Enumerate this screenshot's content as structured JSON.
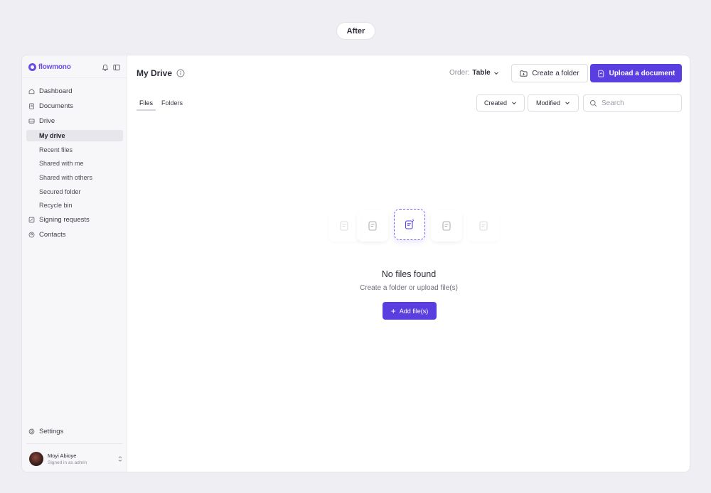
{
  "badge": "After",
  "brand": {
    "name": "flowmono"
  },
  "sidebar": {
    "items": [
      {
        "label": "Dashboard",
        "icon": "home-icon"
      },
      {
        "label": "Documents",
        "icon": "document-icon"
      },
      {
        "label": "Drive",
        "icon": "drive-icon"
      }
    ],
    "drive_sub": [
      {
        "label": "My drive",
        "active": true
      },
      {
        "label": "Recent files"
      },
      {
        "label": "Shared with me"
      },
      {
        "label": "Shared with others"
      },
      {
        "label": "Secured folder"
      },
      {
        "label": "Recycle bin"
      }
    ],
    "items_after": [
      {
        "label": "Signing requests",
        "icon": "signing-icon"
      },
      {
        "label": "Contacts",
        "icon": "contacts-icon"
      }
    ],
    "settings": "Settings",
    "user": {
      "name": "Moyi Abioye",
      "role": "Signed in as admin"
    }
  },
  "header": {
    "title": "My Drive",
    "order_label": "Order:",
    "order_value": "Table",
    "create_folder": "Create a folder",
    "upload": "Upload a document"
  },
  "tabs": [
    "Files",
    "Folders"
  ],
  "filters": {
    "created": "Created",
    "modified": "Modified",
    "search_placeholder": "Search"
  },
  "empty": {
    "title": "No files found",
    "subtitle": "Create a folder or upload file(s)",
    "button": "Add file(s)"
  },
  "colors": {
    "accent": "#5b3ee0",
    "brand": "#6b4ce6"
  }
}
